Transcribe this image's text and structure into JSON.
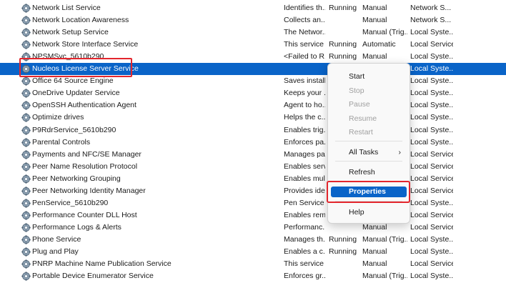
{
  "services": [
    {
      "name": "Network List Service",
      "description": "Identifies th...",
      "status": "Running",
      "startup": "Manual",
      "logon": "Network S..."
    },
    {
      "name": "Network Location Awareness",
      "description": "Collects an...",
      "status": "",
      "startup": "Manual",
      "logon": "Network S..."
    },
    {
      "name": "Network Setup Service",
      "description": "The Networ...",
      "status": "",
      "startup": "Manual (Trig...",
      "logon": "Local Syste..."
    },
    {
      "name": "Network Store Interface Service",
      "description": "This service ...",
      "status": "Running",
      "startup": "Automatic",
      "logon": "Local Service"
    },
    {
      "name": "NPSMSvc_5610b290",
      "description": "<Failed to R...",
      "status": "Running",
      "startup": "Manual",
      "logon": "Local Syste..."
    },
    {
      "name": "Nucleos License Server Service",
      "description": "",
      "status": "",
      "startup": "",
      "logon": "Local Syste...",
      "selected": true
    },
    {
      "name": "Office 64 Source Engine",
      "description": "Saves install...",
      "status": "",
      "startup": "",
      "logon": "Local Syste..."
    },
    {
      "name": "OneDrive Updater Service",
      "description": "Keeps your ...",
      "status": "",
      "startup": "",
      "logon": "Local Syste..."
    },
    {
      "name": "OpenSSH Authentication Agent",
      "description": "Agent to ho...",
      "status": "",
      "startup": "",
      "logon": "Local Syste..."
    },
    {
      "name": "Optimize drives",
      "description": "Helps the c...",
      "status": "",
      "startup": "",
      "logon": "Local Syste..."
    },
    {
      "name": "P9RdrService_5610b290",
      "description": "Enables trig...",
      "status": "",
      "startup": "",
      "logon": "Local Syste..."
    },
    {
      "name": "Parental Controls",
      "description": "Enforces pa...",
      "status": "",
      "startup": "",
      "logon": "Local Syste..."
    },
    {
      "name": "Payments and NFC/SE Manager",
      "description": "Manages pa...",
      "status": "",
      "startup": "",
      "logon": "Local Service"
    },
    {
      "name": "Peer Name Resolution Protocol",
      "description": "Enables serv...",
      "status": "",
      "startup": "",
      "logon": "Local Service"
    },
    {
      "name": "Peer Networking Grouping",
      "description": "Enables mul...",
      "status": "",
      "startup": "",
      "logon": "Local Service"
    },
    {
      "name": "Peer Networking Identity Manager",
      "description": "Provides ide...",
      "status": "",
      "startup": "",
      "logon": "Local Service"
    },
    {
      "name": "PenService_5610b290",
      "description": "Pen Service",
      "status": "",
      "startup": "",
      "logon": "Local Syste..."
    },
    {
      "name": "Performance Counter DLL Host",
      "description": "Enables rem...",
      "status": "",
      "startup": "",
      "logon": "Local Service"
    },
    {
      "name": "Performance Logs & Alerts",
      "description": "Performanc...",
      "status": "",
      "startup": "Manual",
      "logon": "Local Service"
    },
    {
      "name": "Phone Service",
      "description": "Manages th...",
      "status": "Running",
      "startup": "Manual (Trig...",
      "logon": "Local Syste..."
    },
    {
      "name": "Plug and Play",
      "description": "Enables a c...",
      "status": "Running",
      "startup": "Manual",
      "logon": "Local Syste..."
    },
    {
      "name": "PNRP Machine Name Publication Service",
      "description": "This service ...",
      "status": "",
      "startup": "Manual",
      "logon": "Local Service"
    },
    {
      "name": "Portable Device Enumerator Service",
      "description": "Enforces gr...",
      "status": "",
      "startup": "Manual (Trig...",
      "logon": "Local Syste..."
    }
  ],
  "context_menu": {
    "start": "Start",
    "stop": "Stop",
    "pause": "Pause",
    "resume": "Resume",
    "restart": "Restart",
    "all_tasks": "All Tasks",
    "all_tasks_arrow": "›",
    "refresh": "Refresh",
    "properties": "Properties",
    "help": "Help"
  },
  "colors": {
    "selection": "#0a64c8",
    "annotation_box": "#e3262d"
  },
  "icons": {
    "service": "gear-icon"
  }
}
